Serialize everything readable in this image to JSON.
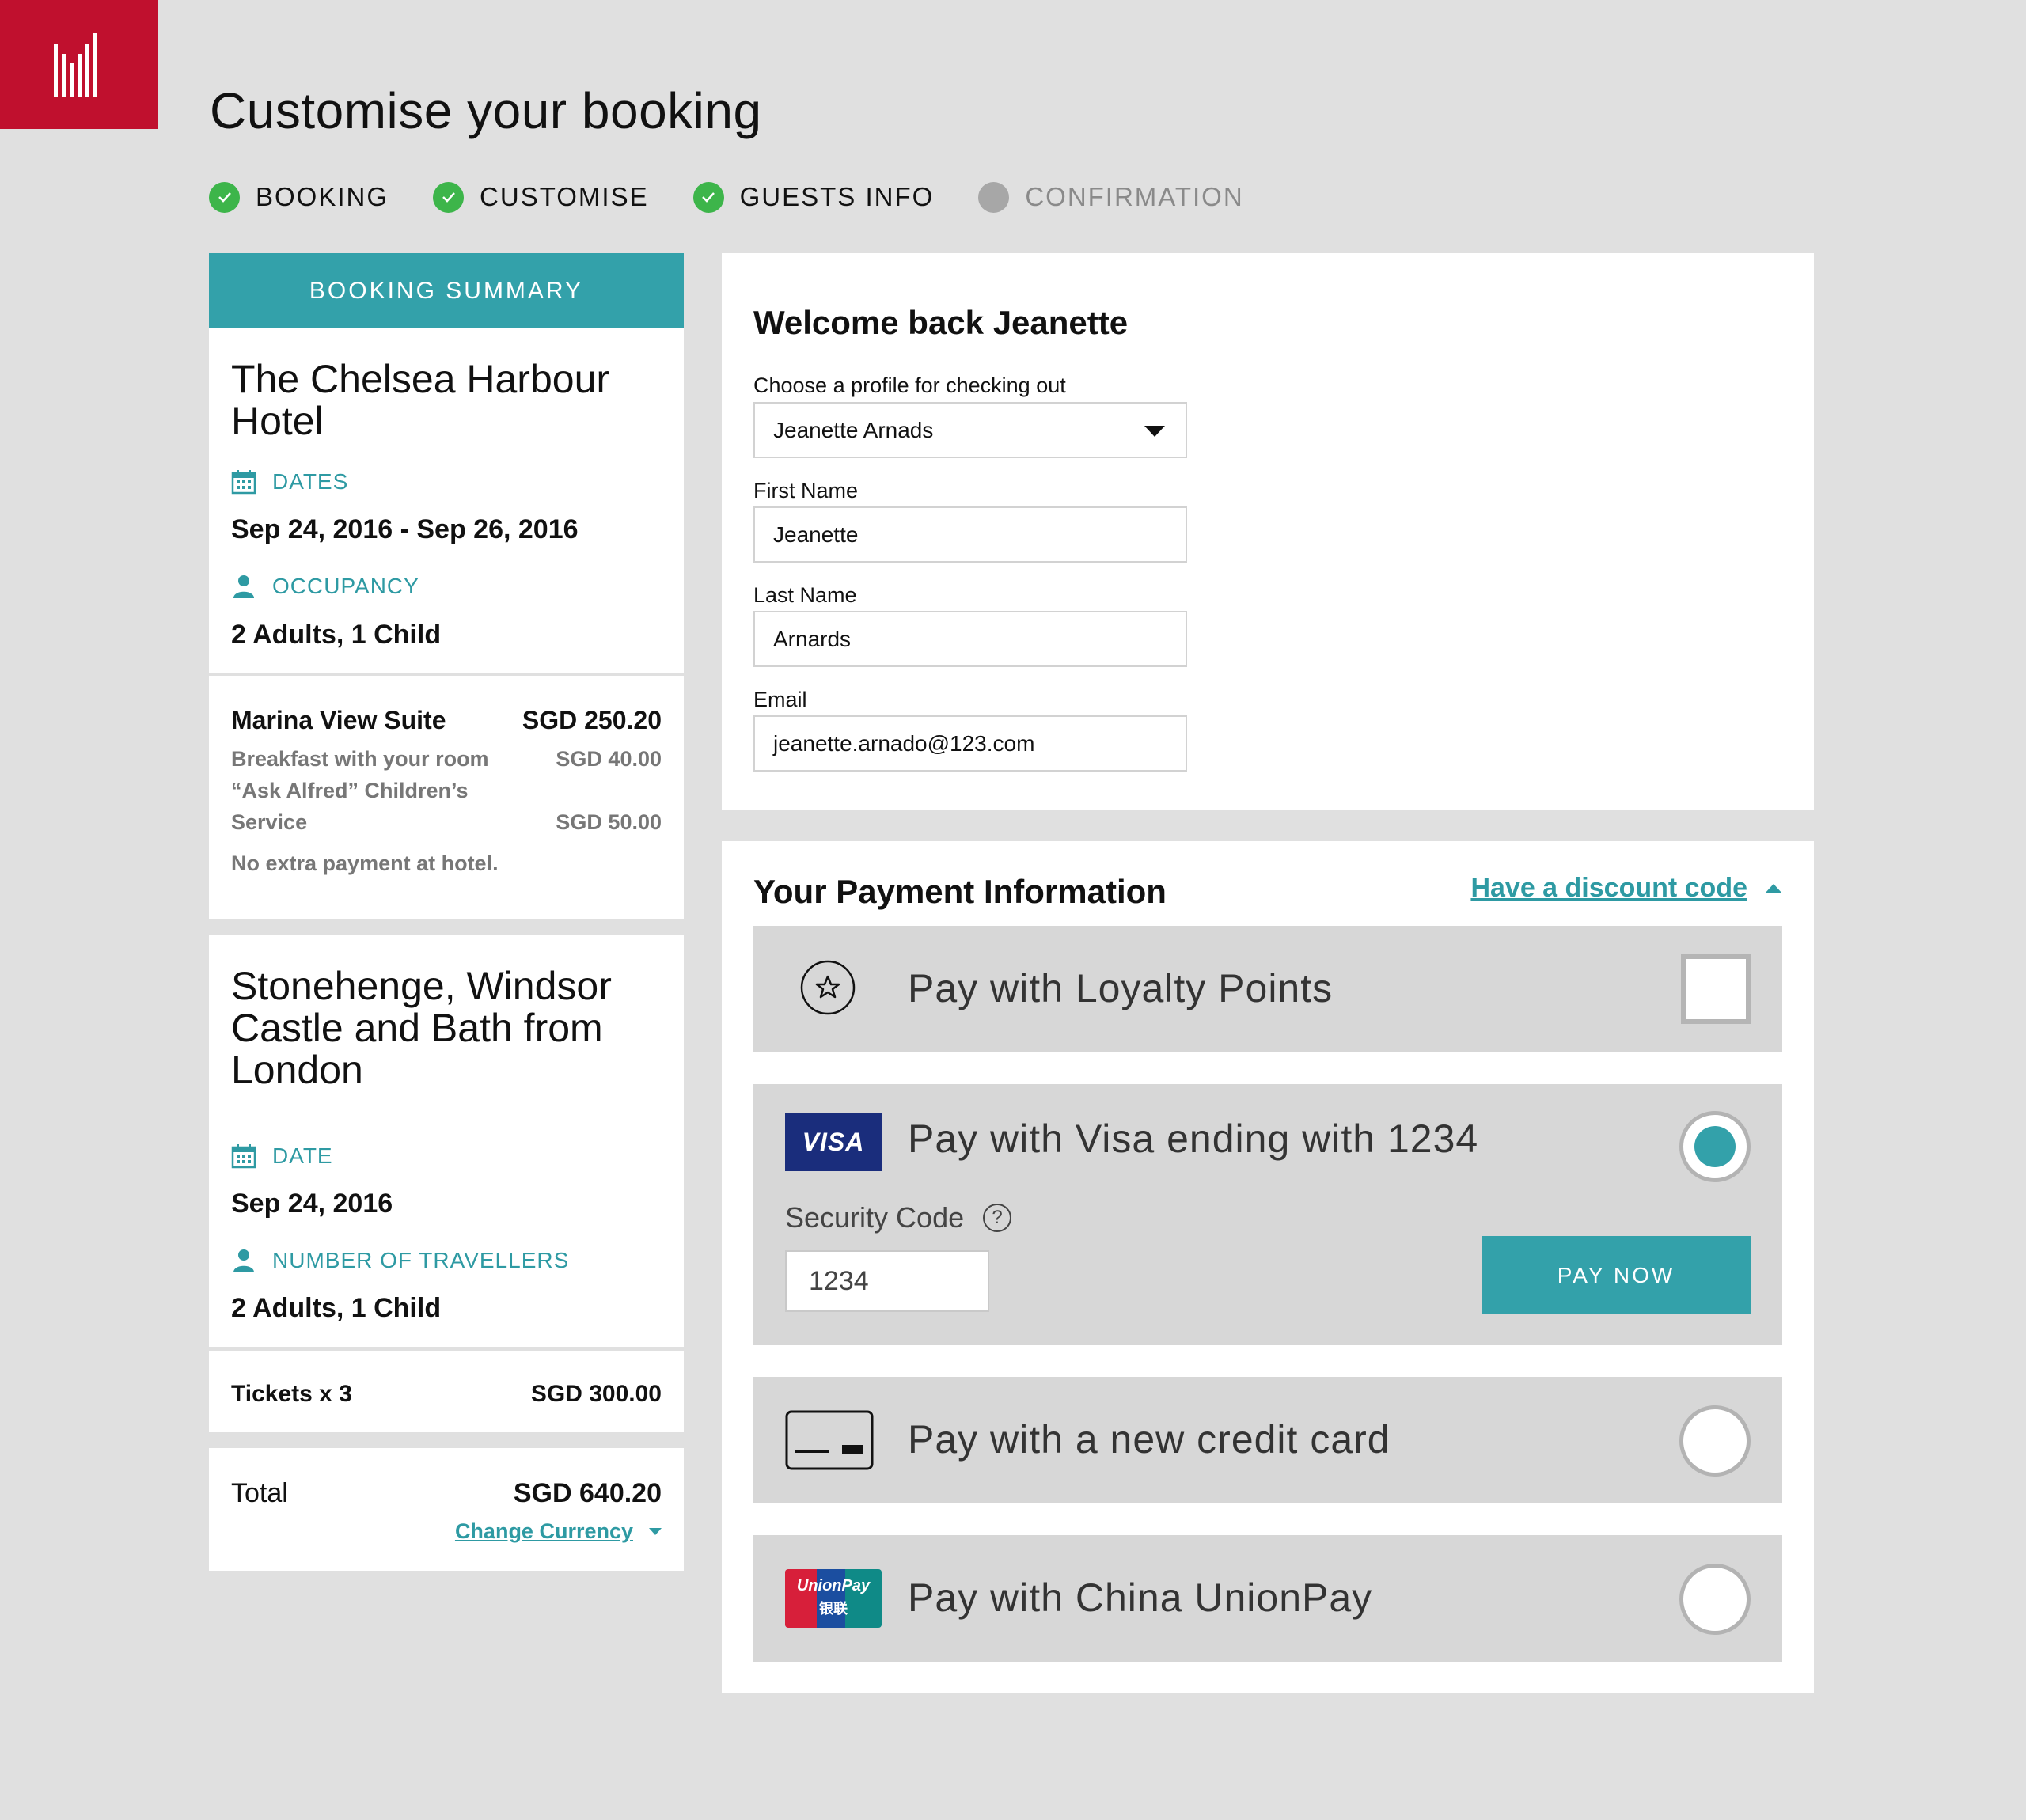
{
  "page": {
    "title": "Customise your booking"
  },
  "brand": {
    "primary": "#c0102e",
    "accent": "#33a1aa",
    "success": "#3db54a"
  },
  "steps": [
    {
      "label": "BOOKING",
      "status": "done"
    },
    {
      "label": "CUSTOMISE",
      "status": "done"
    },
    {
      "label": "GUESTS INFO",
      "status": "done"
    },
    {
      "label": "CONFIRMATION",
      "status": "pending"
    }
  ],
  "summary": {
    "header": "BOOKING SUMMARY",
    "hotel": {
      "name": "The Chelsea Harbour Hotel",
      "dates_label": "DATES",
      "dates": "Sep 24, 2016 - Sep 26, 2016",
      "occupancy_label": "OCCUPANCY",
      "occupancy": "2 Adults, 1 Child"
    },
    "suite": {
      "name": "Marina View Suite",
      "price": "SGD 250.20",
      "extras": [
        {
          "label": "Breakfast with your room",
          "price": "SGD 40.00"
        },
        {
          "label": "“Ask Alfred” Children’s",
          "label2": "Service",
          "price": "SGD 50.00"
        }
      ],
      "note": "No extra payment at hotel."
    },
    "tour": {
      "name": "Stonehenge, Windsor Castle and Bath from London",
      "date_label": "DATE",
      "date": "Sep 24, 2016",
      "travellers_label": "NUMBER OF TRAVELLERS",
      "travellers": "2 Adults, 1 Child"
    },
    "tickets": {
      "label": "Tickets x 3",
      "price": "SGD 300.00"
    },
    "total": {
      "label": "Total",
      "price": "SGD 640.20",
      "change_currency": "Change Currency"
    }
  },
  "profile": {
    "title": "Welcome back Jeanette",
    "choose_label": "Choose a profile for checking out",
    "selected_profile": "Jeanette Arnads",
    "first_name_label": "First Name",
    "first_name": "Jeanette",
    "last_name_label": "Last Name",
    "last_name": "Arnards",
    "email_label": "Email",
    "email": "jeanette.arnado@123.com"
  },
  "payment": {
    "title": "Your Payment Information",
    "discount_link": "Have a discount code",
    "loyalty": {
      "label": "Pay with Loyalty Points",
      "icon": "star-icon",
      "checked": false
    },
    "visa": {
      "label": "Pay with Visa ending with 1234",
      "badge": "VISA",
      "selected": true,
      "security_code_label": "Security Code",
      "security_code_value": "1234",
      "pay_now": "PAY NOW"
    },
    "new_card": {
      "label": "Pay with a new credit card",
      "icon": "credit-card-icon",
      "selected": false
    },
    "unionpay": {
      "label": "Pay with China UnionPay",
      "badge_line1": "UnionPay",
      "badge_line2": "银联",
      "selected": false
    }
  }
}
